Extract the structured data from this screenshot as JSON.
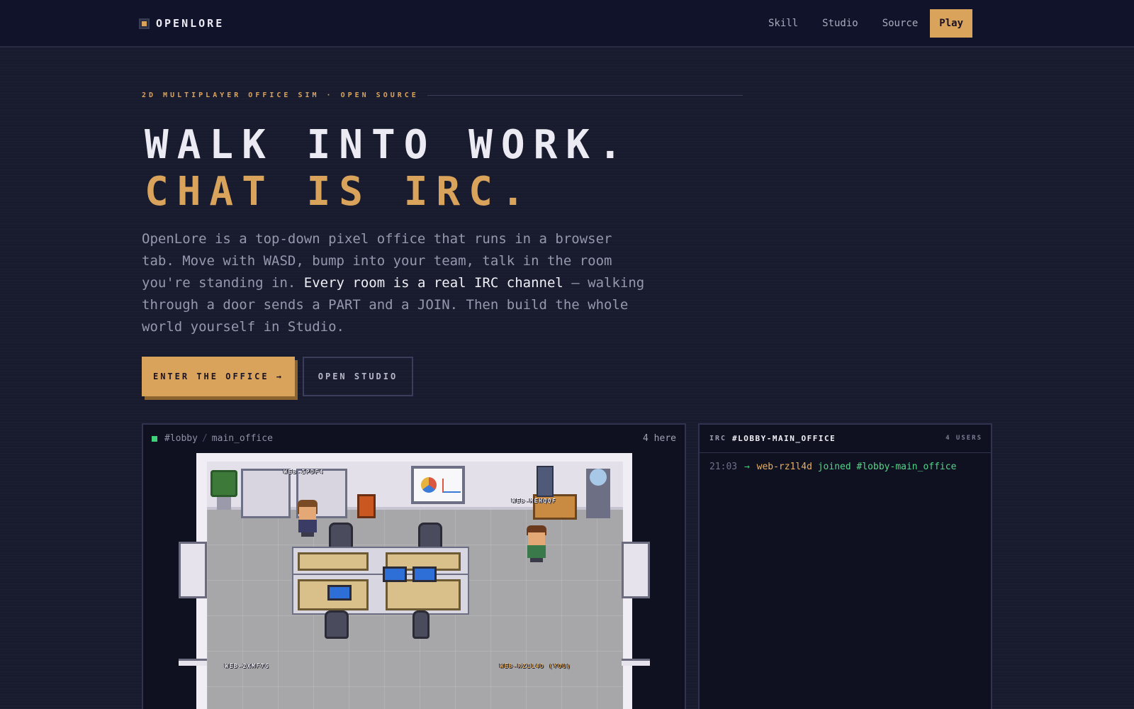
{
  "nav": {
    "brand": "OPENLORE",
    "links": [
      "Skill",
      "Studio",
      "Source"
    ],
    "cta": "Play"
  },
  "hero": {
    "eyebrow": "2D MULTIPLAYER OFFICE SIM · OPEN SOURCE",
    "headline_line1": "WALK INTO WORK.",
    "headline_line2": "CHAT IS IRC.",
    "lead_part1": "OpenLore is a top-down pixel office that runs in a browser tab. Move with WASD, bump into your team, talk in the room you're standing in.",
    "lead_strong": "Every room is a real IRC channel",
    "lead_part2": "— walking through a door sends a PART and a JOIN. Then build the whole world yourself in Studio.",
    "primary_button": "ENTER THE OFFICE →",
    "secondary_button": "OPEN STUDIO"
  },
  "game": {
    "room": "#lobby",
    "separator": "/",
    "sub_room": "main_office",
    "here_count": "4 here",
    "players": [
      {
        "name": "WEB-IPDF4"
      },
      {
        "name": "WEB-MEHQQF"
      },
      {
        "name": "WEB-2XMF7G"
      },
      {
        "name": "WEB-RZ1L4D (YOU)"
      }
    ]
  },
  "irc": {
    "label": "IRC",
    "channel": "#LOBBY-MAIN_OFFICE",
    "users": "4 USERS",
    "messages": [
      {
        "time": "21:03",
        "arrow": "→",
        "nick": "web-rz1l4d",
        "verb": "joined",
        "channel": "#lobby-main_office"
      }
    ]
  },
  "colors": {
    "accent": "#d9a35b",
    "background": "#181b2e",
    "online": "#3fd07a"
  }
}
